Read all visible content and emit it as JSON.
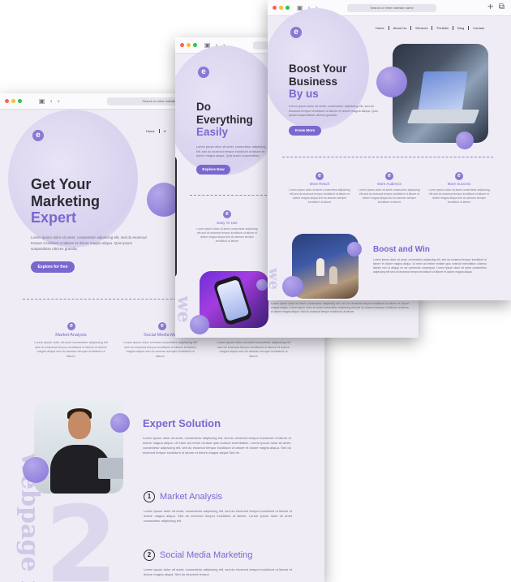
{
  "browser": {
    "address_text": "Search or enter website name",
    "address_text_top": "Search or enter website name"
  },
  "page1": {
    "menu": [
      "Home",
      "H"
    ],
    "heading_line1": "Get Your",
    "heading_line2": "Marketing",
    "heading_accent": "Expert",
    "intro": "Lorem ipsum dolor sit amet, consectetur adipiscing elit, sed do eiusmod tempor incididunt ut labore et dolore magna aliqua. Quis ipsum suspendisse ultrices gravida.",
    "cta": "Explore for free",
    "features": [
      {
        "title": "Market Analysis",
        "text": "Lorem ipsum dolor sit amet consectetur adipiscing elit sed do eiusmod tempor incididunt ut labore et dolore magna aliqua sed do aenean semper incididunt ut labore"
      },
      {
        "title": "Social Media Ma",
        "text": "Lorem ipsum dolor sit amet consectetur adipiscing elit sed do eiusmod tempor incididunt ut labore et dolore magna aliqua sed do aenean semper incididunt ut labore"
      },
      {
        "title": "",
        "text": "Lorem ipsum dolor sit amet consectetur adipiscing elit sed do eiusmod tempor incididunt ut labore et dolore magna aliqua sed do aenean semper incididunt ut labore"
      }
    ],
    "expert_title": "Expert Solution",
    "expert_text": "Lorem ipsum dolor sit amet, consectetur adipiscing elit, sed do eiusmod tempor incididunt ut labore et dolore magna aliqua. Ut enim ad minim veniam quis nostrud exercitation. Lorem ipsum dolor sit amet, consectetur adipiscing elit, sed do eiusmod tempor incididunt ut labore et dolore magna aliqua. Sed do eiusmod tempor incididunt ut labore et dolore magna aliqua Sed do",
    "items": [
      {
        "num": "1",
        "title": "Market Analysis",
        "text": "Lorem ipsum dolor sit amet, consectetur adipiscing elit, sed do eiusmod tempor incididunt ut labore et dolore magna aliqua. Sed do eiusmod tempor incididunt ut labore. Lorem ipsum dolor sit amet consectetur adipiscing elit."
      },
      {
        "num": "2",
        "title": "Social Media Marketing",
        "text": "Lorem ipsum dolor sit amet, consectetur adipiscing elit, sed do eiusmod tempor incididunt ut labore et dolore magna aliqua. Sed do eiusmod tempor"
      }
    ],
    "watermark": "webpage m",
    "big_number": "2"
  },
  "page2": {
    "heading_line1": "Do",
    "heading_line2": "Everything",
    "heading_accent": "Easily",
    "intro": "Lorem ipsum dolor sit amet, consectetur adipiscing elit, sed do eiusmod tempor incididunt ut labore et dolore magna aliqua. Quis ipsum suspendisse.",
    "cta": "Explore Now",
    "feature_title": "Easy To Use",
    "feature_text": "Lorem ipsum dolor sit amet consectetur adipiscing elit sed do eiusmod tempor incididunt ut labore et dolore magna aliqua sed do aenean semper incididunt ut labore",
    "watermark": "we"
  },
  "page3": {
    "menu": [
      "Home",
      "About Us",
      "Services",
      "Portfolio",
      "Blog",
      "Contact"
    ],
    "heading_line1": "Boost Your",
    "heading_line2": "Business",
    "heading_accent": "By us",
    "intro": "Lorem ipsum dolor sit amet, consectetur adipiscing elit, sed do eiusmod tempor incididunt ut labore et dolore magna aliqua. Quis ipsum suspendisse ultrices gravida.",
    "cta": "Know More",
    "features": [
      {
        "title": "More Reach",
        "text": "Lorem ipsum dolor sit amet consectetur adipiscing elit sed do eiusmod tempor incididunt ut labore et dolore magna aliqua sed do aenean semper incididunt ut labore"
      },
      {
        "title": "More Audience",
        "text": "Lorem ipsum dolor sit amet consectetur adipiscing elit sed do eiusmod tempor incididunt ut labore et dolore magna aliqua sed do aenean semper incididunt ut labore"
      },
      {
        "title": "More Success",
        "text": "Lorem ipsum dolor sit amet consectetur adipiscing elit sed do eiusmod tempor incididunt ut labore et dolore magna aliqua sed do aenean semper incididunt ut labore"
      }
    ],
    "win_title": "Boost and Win",
    "win_text": "Lorem ipsum dolor sit amet, consectetur adipiscing elit, sed do eiusmod tempor incididunt ut labore et dolore magna aliqua. Ut enim ad minim veniam quis nostrud exercitation ullamco laboris nisi ut aliquip ex ea commodo consequat. Lorem ipsum dolor sit amet consectetur adipiscing elit sed do eiusmod tempor incididunt ut labore et dolore magna aliqua.",
    "lower_text": "Lorem ipsum dolor sit amet, consectetur adipiscing elit, sed do eiusmod tempor incididunt ut labore et dolore magna aliqua. Lorem ipsum dolor sit amet consectetur adipiscing elit sed do eiusmod tempor incididunt ut labore et dolore magna aliqua. Sed do eiusmod tempor incididunt ut labore.",
    "watermark": "we"
  }
}
